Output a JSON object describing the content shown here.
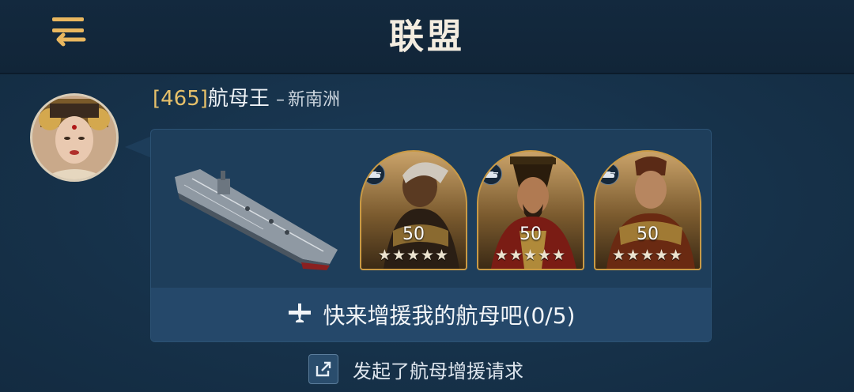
{
  "header": {
    "title": "联盟",
    "menu_icon": "menu-return-icon"
  },
  "message": {
    "sender_level": "[465]",
    "sender_name": "航母王",
    "separator": "–",
    "server": "新南洲",
    "avatar": "female-commander-portrait"
  },
  "card": {
    "ship_icon": "aircraft-carrier-image",
    "heroes": [
      {
        "level": "50",
        "stars": "★★★★★",
        "badge_icon": "tank-icon",
        "portrait": "swordsman-hero-portrait"
      },
      {
        "level": "50",
        "stars": "★★★★★",
        "badge_icon": "tank-icon",
        "portrait": "emperor-hero-portrait"
      },
      {
        "level": "50",
        "stars": "★★★★★",
        "badge_icon": "tank-icon",
        "portrait": "general-hero-portrait"
      }
    ],
    "plane_icon": "airplane-icon",
    "reinforce_text": "快来增援我的航母吧(0/5)"
  },
  "footer": {
    "share_icon": "share-icon",
    "text": "发起了航母增援请求"
  }
}
